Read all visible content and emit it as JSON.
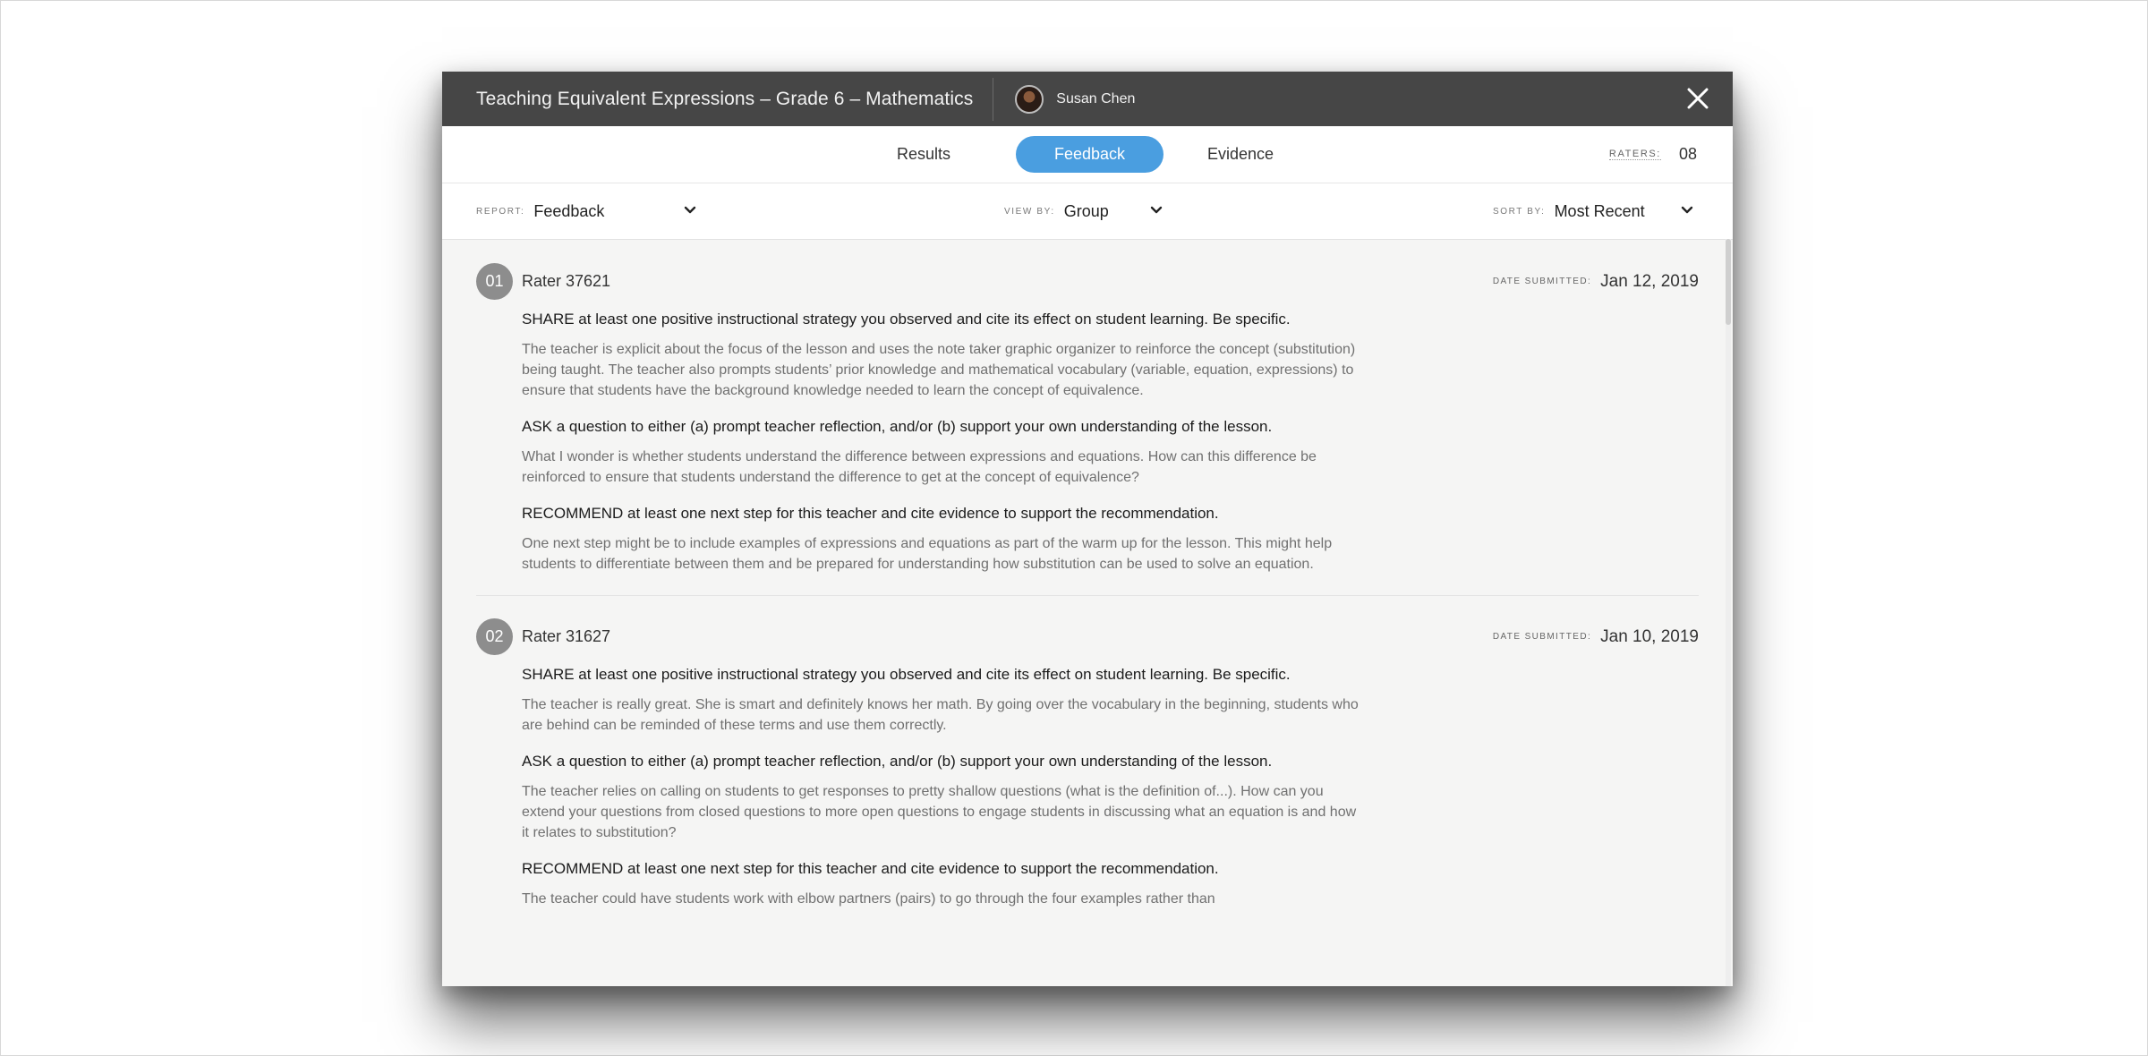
{
  "window": {
    "title": "Teaching Equivalent Expressions – Grade 6 – Mathematics",
    "user_name": "Susan Chen"
  },
  "tabs": {
    "results": "Results",
    "feedback": "Feedback",
    "evidence": "Evidence",
    "active": "Feedback"
  },
  "raters": {
    "label": "RATERS:",
    "value": "08"
  },
  "filters": {
    "report": {
      "label": "REPORT:",
      "value": "Feedback"
    },
    "view_by": {
      "label": "VIEW BY:",
      "value": "Group"
    },
    "sort_by": {
      "label": "SORT BY:",
      "value": "Most Recent"
    }
  },
  "date_label": "DATE SUBMITTED:",
  "entries": [
    {
      "number": "01",
      "rater": "Rater 37621",
      "date": "Jan 12, 2019",
      "items": [
        {
          "question": "SHARE at least one positive instructional strategy you observed and cite its effect on student learning. Be specific.",
          "answer": "The teacher is explicit about the focus of the lesson and uses the note taker graphic organizer to reinforce the concept (substitution) being taught. The teacher also prompts students’ prior knowledge and mathematical vocabulary (variable, equation, expressions) to ensure that students have the background knowledge needed to learn the concept of equivalence."
        },
        {
          "question": "ASK a question to either (a) prompt teacher reflection, and/or (b) support your own understanding of the lesson.",
          "answer": "What I wonder is whether students understand the difference between expressions and equations. How can this difference be reinforced to ensure that students understand the difference to get at the concept of equivalence?"
        },
        {
          "question": "RECOMMEND at least one next step for this teacher and cite evidence to support the recommendation.",
          "answer": "One next step might be to include examples of expressions and equations as part of the warm up for the lesson. This might help students to differentiate between them and be prepared for understanding how substitution can be used to solve an equation."
        }
      ]
    },
    {
      "number": "02",
      "rater": "Rater 31627",
      "date": "Jan 10, 2019",
      "items": [
        {
          "question": "SHARE at least one positive instructional strategy you observed and cite its effect on student learning. Be specific.",
          "answer": "The teacher is really great. She is smart and definitely knows her math. By going over the vocabulary in the beginning, students who are behind can be reminded of these terms and use them correctly."
        },
        {
          "question": "ASK a question to either (a) prompt teacher reflection, and/or (b) support your own understanding of the lesson.",
          "answer": "The teacher relies on calling on students to get responses to pretty shallow questions (what is the definition of...). How can you extend your questions from closed questions to more open questions to engage students in discussing what an equation is and how it relates to substitution?"
        },
        {
          "question": "RECOMMEND at least one next step for this teacher and cite evidence to support the recommendation.",
          "answer": "The teacher could have students work with elbow partners (pairs) to go through the four examples rather than"
        }
      ]
    }
  ]
}
